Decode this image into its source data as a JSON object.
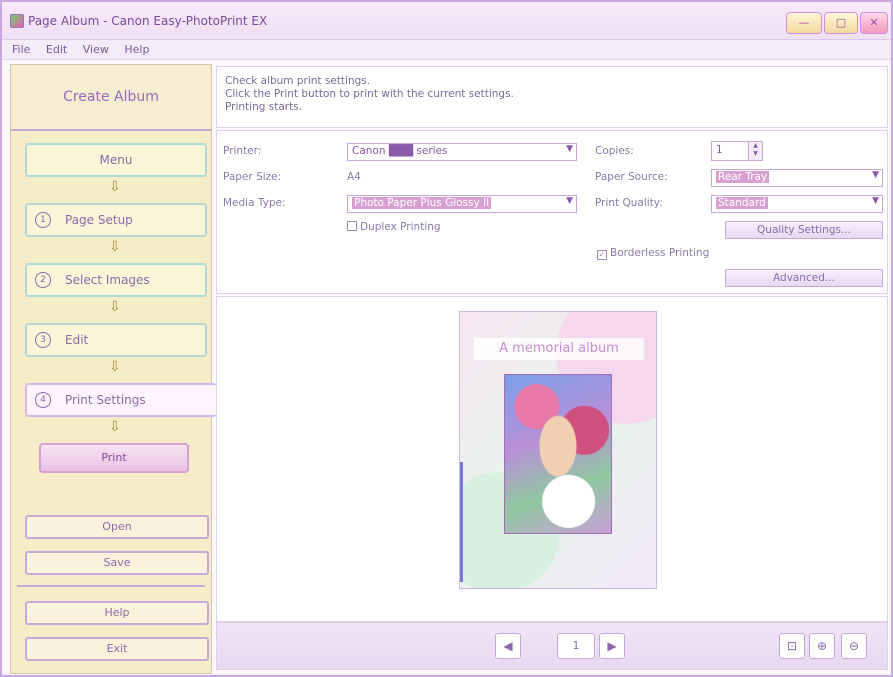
{
  "window": {
    "title": "Page Album - Canon Easy-PhotoPrint EX",
    "min_glyph": "—",
    "max_glyph": "□",
    "close_glyph": "✕"
  },
  "menu": [
    "File",
    "Edit",
    "View",
    "Help"
  ],
  "sidebar": {
    "header": "Create Album",
    "steps": [
      {
        "num": "",
        "label": "Menu"
      },
      {
        "num": "1",
        "label": "Page Setup"
      },
      {
        "num": "2",
        "label": "Select Images"
      },
      {
        "num": "3",
        "label": "Edit"
      },
      {
        "num": "4",
        "label": "Print Settings"
      }
    ],
    "print_button": "Print",
    "open_button": "Open",
    "save_button": "Save",
    "help_button": "Help",
    "exit_button": "Exit",
    "arrow_glyph": "⇩"
  },
  "instructions": {
    "line1": "Check album print settings.",
    "line2": "Click the Print button to print with the current settings.",
    "line3": "Printing starts."
  },
  "settings": {
    "printer_label": "Printer:",
    "printer_value": "Canon ███ series",
    "paper_size_label": "Paper Size:",
    "paper_size_value": "A4",
    "media_type_label": "Media Type:",
    "media_type_value": "Photo Paper Plus Glossy II",
    "duplex_label": "Duplex Printing",
    "copies_label": "Copies:",
    "copies_value": "1",
    "paper_source_label": "Paper Source:",
    "paper_source_value": "Rear Tray",
    "print_quality_label": "Print Quality:",
    "print_quality_value": "Standard",
    "quality_settings_button": "Quality Settings...",
    "borderless_label": "Borderless Printing",
    "borderless_checked": true,
    "advanced_button": "Advanced..."
  },
  "preview": {
    "caption": "A memorial album"
  },
  "toolbar": {
    "prev_glyph": "◀",
    "page_value": "1",
    "next_glyph": "▶",
    "fit_glyph": "⊡",
    "zoom_in_glyph": "⊕",
    "zoom_out_glyph": "⊖"
  },
  "colors": {
    "accent": "#c8a8d8",
    "sidebar_bg": "#f5ecc8"
  }
}
